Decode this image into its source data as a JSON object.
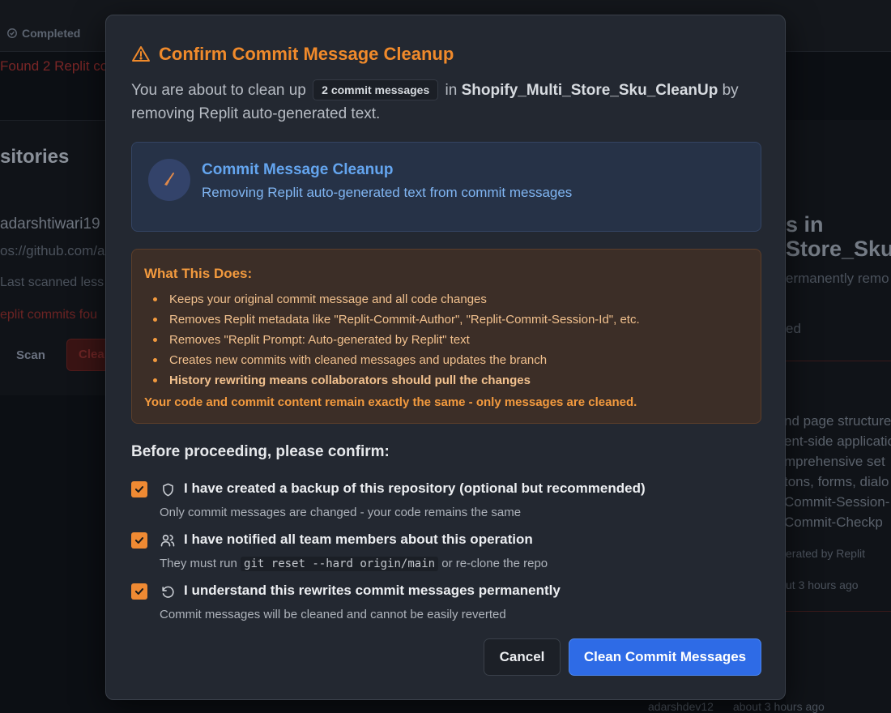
{
  "background": {
    "status_completed": "Completed",
    "found_text": "Found 2 Replit co",
    "repositories_heading": "sitories",
    "username": "adarshtiwari19",
    "repo_url": "os://github.com/a",
    "last_scanned": "Last scanned less",
    "replit_commits": "eplit commits fou",
    "scan_button": "Scan",
    "clean_button": "Clea",
    "right_title_line1": "s in",
    "right_title_line2": "Store_Sku_",
    "right_subtitle": "ermanently remo",
    "right_status": "ed",
    "right_lines": [
      "nd page structure",
      "ent-side applicatio",
      "mprehensive set",
      "tons, forms, dialo",
      "Commit-Session-",
      "Commit-Checkp"
    ],
    "right_generated": "erated by Replit",
    "right_time": "ut 3 hours ago",
    "bottom_author": "adarshdev12",
    "bottom_time": "about 3 hours ago"
  },
  "modal": {
    "title": "Confirm Commit Message Cleanup",
    "desc_prefix": "You are about to clean up",
    "commit_count_pill": "2 commit messages",
    "desc_in": "in",
    "repo_name": "Shopify_Multi_Store_Sku_CleanUp",
    "desc_suffix": "by removing Replit auto-generated text.",
    "info": {
      "title": "Commit Message Cleanup",
      "subtitle": "Removing Replit auto-generated text from commit messages"
    },
    "warning": {
      "title": "What This Does:",
      "items": [
        "Keeps your original commit message and all code changes",
        "Removes Replit metadata like \"Replit-Commit-Author\", \"Replit-Commit-Session-Id\", etc.",
        "Removes \"Replit Prompt: Auto-generated by Replit\" text",
        "Creates new commits with cleaned messages and updates the branch",
        "History rewriting means collaborators should pull the changes"
      ],
      "footer": "Your code and commit content remain exactly the same - only messages are cleaned."
    },
    "confirm_heading": "Before proceeding, please confirm:",
    "checks": [
      {
        "label": "I have created a backup of this repository (optional but recommended)",
        "hint": "Only commit messages are changed - your code remains the same",
        "checked": true,
        "icon": "shield-icon"
      },
      {
        "label": "I have notified all team members about this operation",
        "hint_prefix": "They must run",
        "hint_code": "git reset --hard origin/main",
        "hint_suffix": "or re-clone the repo",
        "checked": true,
        "icon": "users-icon"
      },
      {
        "label": "I understand this rewrites commit messages permanently",
        "hint": "Commit messages will be cleaned and cannot be easily reverted",
        "checked": true,
        "icon": "rotate-ccw-icon"
      }
    ],
    "cancel_label": "Cancel",
    "confirm_label": "Clean Commit Messages"
  },
  "colors": {
    "accent_orange": "#f08a2b",
    "primary_blue": "#2e6be6",
    "info_blue": "#64a5ef",
    "modal_bg": "#232831"
  }
}
